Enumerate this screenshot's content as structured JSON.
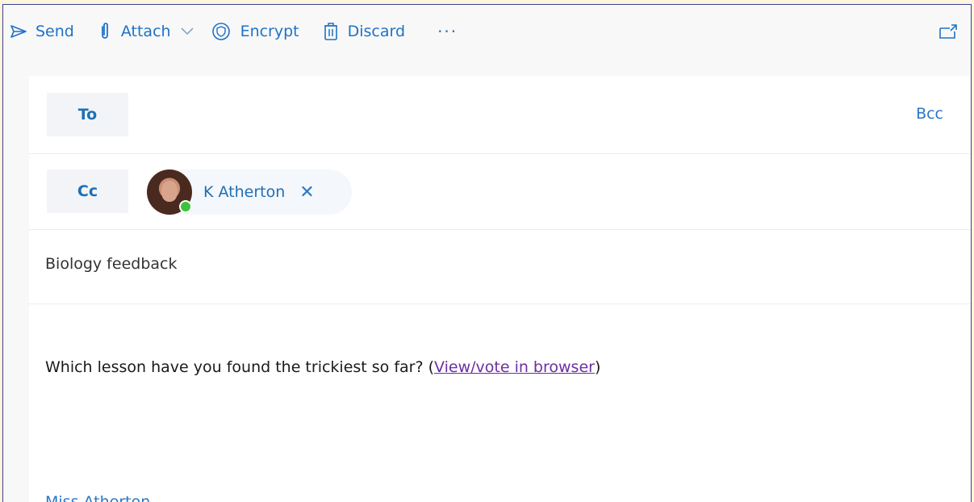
{
  "toolbar": {
    "send_label": "Send",
    "attach_label": "Attach",
    "encrypt_label": "Encrypt",
    "discard_label": "Discard",
    "more_label": "···",
    "icons": [
      "send-icon",
      "paperclip-icon",
      "chevron-down-icon",
      "encrypt-shield-icon",
      "trash-icon",
      "popout-icon"
    ]
  },
  "recipients": {
    "to_label": "To",
    "bcc_label": "Bcc",
    "cc_label": "Cc",
    "cc_chips": [
      {
        "name": "K Atherton",
        "remove_label": "✕",
        "status": "online"
      }
    ]
  },
  "subject": "Biology feedback",
  "body": {
    "text": "Which lesson have you found the trickiest so far? (",
    "link_label": "View/vote in browser",
    "text_after": ")",
    "signature": "Miss Atherton"
  },
  "colors": {
    "accent": "#1f6fb5",
    "link_visited": "#6b2fa0",
    "status_online": "#3cc43c"
  }
}
